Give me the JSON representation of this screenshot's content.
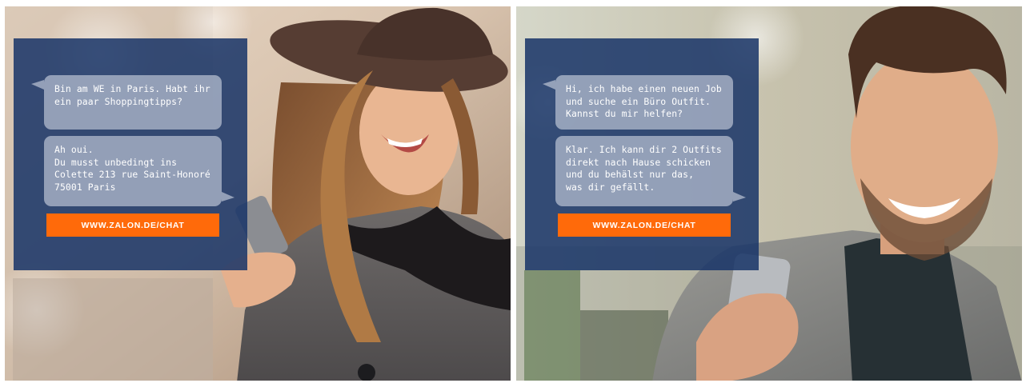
{
  "ads": [
    {
      "messages": [
        "Bin am WE in Paris. Habt ihr\nein paar Shoppingtipps?",
        "Ah oui.\nDu musst unbedingt ins\nColette 213 rue Saint-Honoré\n75001 Paris"
      ],
      "cta_label": "WWW.ZALON.DE/CHAT"
    },
    {
      "messages": [
        "Hi, ich habe einen neuen Job\nund suche ein Büro Outfit.\nKannst du mir helfen?",
        "Klar. Ich kann dir 2 Outfits\ndirekt nach Hause schicken\nund du behälst nur das,\nwas dir gefällt."
      ],
      "cta_label": "WWW.ZALON.DE/CHAT"
    }
  ],
  "colors": {
    "card_bg": "#183468",
    "bubble_bg": "#ced5e2",
    "cta_bg": "#ff6a0a",
    "text": "#ffffff"
  }
}
